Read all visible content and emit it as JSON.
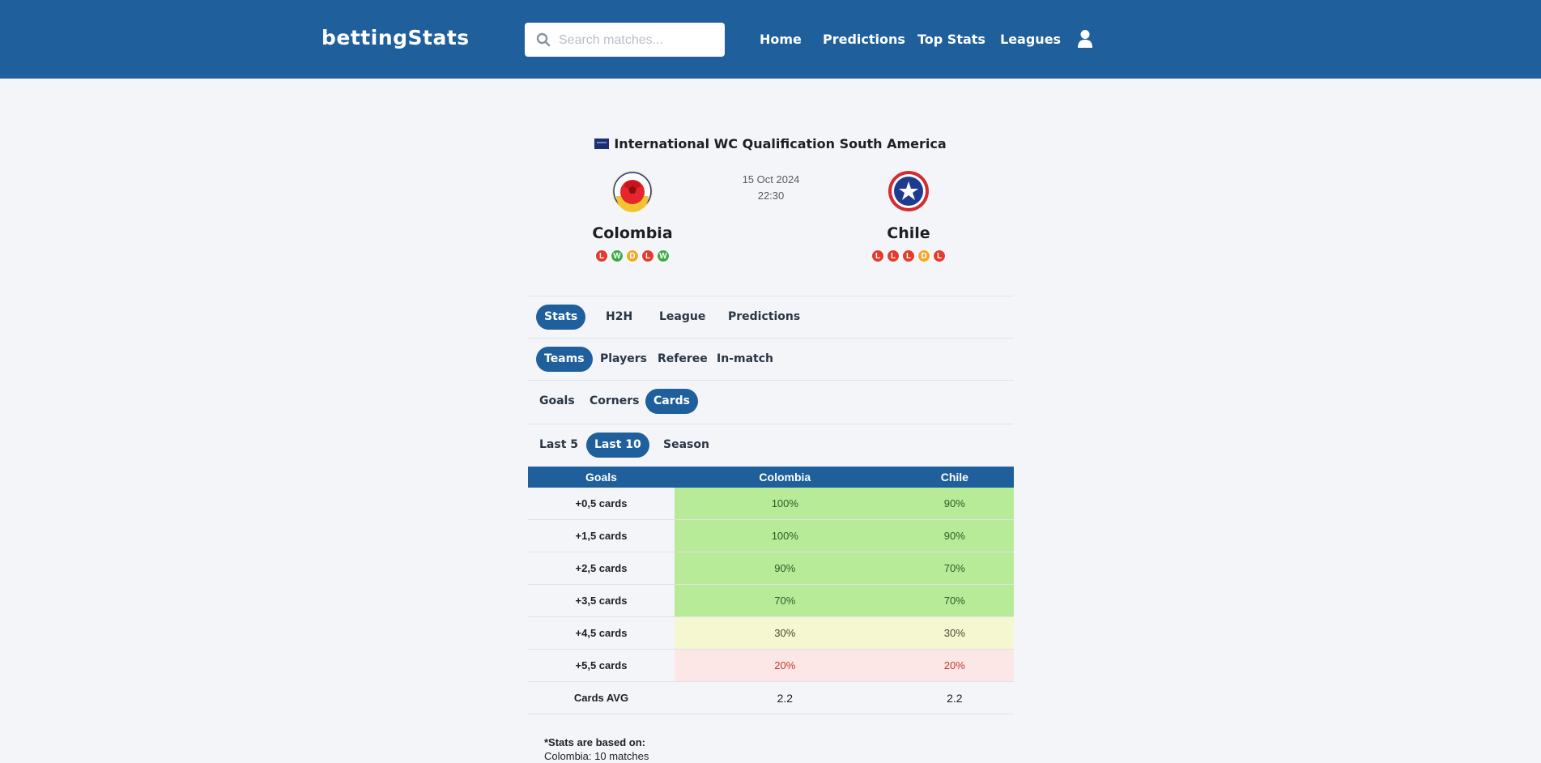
{
  "header": {
    "logo": "bettingStats",
    "search_placeholder": "Search matches...",
    "nav": [
      "Home",
      "Predictions",
      "Top Stats",
      "Leagues"
    ]
  },
  "match": {
    "competition": "International WC Qualification South America",
    "date": "15 Oct 2024",
    "time": "22:30",
    "home": {
      "name": "Colombia",
      "form": [
        "L",
        "W",
        "D",
        "L",
        "W"
      ]
    },
    "away": {
      "name": "Chile",
      "form": [
        "L",
        "L",
        "L",
        "D",
        "L"
      ]
    }
  },
  "tabs": {
    "main": [
      "Stats",
      "H2H",
      "League",
      "Predictions"
    ],
    "main_active": "Stats",
    "scope": [
      "Teams",
      "Players",
      "Referee",
      "In-match"
    ],
    "scope_active": "Teams",
    "category": [
      "Goals",
      "Corners",
      "Cards"
    ],
    "category_active": "Cards",
    "range": [
      "Last 5",
      "Last 10",
      "Season"
    ],
    "range_active": "Last 10"
  },
  "table": {
    "headers": [
      "Goals",
      "Colombia",
      "Chile"
    ],
    "rows": [
      {
        "label": "+0,5 cards",
        "home": "100%",
        "away": "90%",
        "tone": "green"
      },
      {
        "label": "+1,5 cards",
        "home": "100%",
        "away": "90%",
        "tone": "green"
      },
      {
        "label": "+2,5 cards",
        "home": "90%",
        "away": "70%",
        "tone": "green"
      },
      {
        "label": "+3,5 cards",
        "home": "70%",
        "away": "70%",
        "tone": "green"
      },
      {
        "label": "+4,5 cards",
        "home": "30%",
        "away": "30%",
        "tone": "yellow"
      },
      {
        "label": "+5,5 cards",
        "home": "20%",
        "away": "20%",
        "tone": "red"
      },
      {
        "label": "Cards AVG",
        "home": "2.2",
        "away": "2.2",
        "tone": "plain"
      }
    ]
  },
  "footnote": {
    "heading": "*Stats are based on:",
    "lines": [
      "Colombia: 10 matches"
    ]
  },
  "colors": {
    "brand": "#1e5f9c",
    "win": "#3daa46",
    "loss": "#e43b2d",
    "draw": "#f2a828"
  }
}
